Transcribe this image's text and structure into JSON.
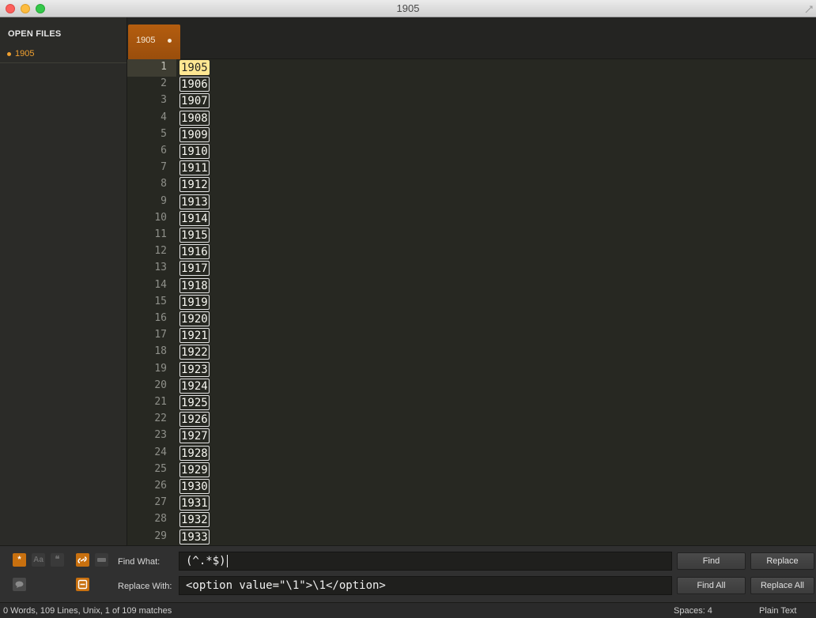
{
  "window": {
    "title": "1905"
  },
  "sidebar": {
    "header": "OPEN FILES",
    "files": [
      {
        "label": "1905",
        "modified": true
      }
    ]
  },
  "tabs": [
    {
      "label": "1905",
      "modified": true,
      "active": true
    }
  ],
  "editor": {
    "current_line": 1,
    "lines": [
      {
        "n": "1",
        "text": "1905"
      },
      {
        "n": "2",
        "text": "1906"
      },
      {
        "n": "3",
        "text": "1907"
      },
      {
        "n": "4",
        "text": "1908"
      },
      {
        "n": "5",
        "text": "1909"
      },
      {
        "n": "6",
        "text": "1910"
      },
      {
        "n": "7",
        "text": "1911"
      },
      {
        "n": "8",
        "text": "1912"
      },
      {
        "n": "9",
        "text": "1913"
      },
      {
        "n": "10",
        "text": "1914"
      },
      {
        "n": "11",
        "text": "1915"
      },
      {
        "n": "12",
        "text": "1916"
      },
      {
        "n": "13",
        "text": "1917"
      },
      {
        "n": "14",
        "text": "1918"
      },
      {
        "n": "15",
        "text": "1919"
      },
      {
        "n": "16",
        "text": "1920"
      },
      {
        "n": "17",
        "text": "1921"
      },
      {
        "n": "18",
        "text": "1922"
      },
      {
        "n": "19",
        "text": "1923"
      },
      {
        "n": "20",
        "text": "1924"
      },
      {
        "n": "21",
        "text": "1925"
      },
      {
        "n": "22",
        "text": "1926"
      },
      {
        "n": "23",
        "text": "1927"
      },
      {
        "n": "24",
        "text": "1928"
      },
      {
        "n": "25",
        "text": "1929"
      },
      {
        "n": "26",
        "text": "1930"
      },
      {
        "n": "27",
        "text": "1931"
      },
      {
        "n": "28",
        "text": "1932"
      },
      {
        "n": "29",
        "text": "1933"
      }
    ]
  },
  "find_panel": {
    "options": {
      "regex": {
        "icon": "asterisk-icon",
        "glyph": "*",
        "on": true
      },
      "case_sensitive": {
        "icon": "case-icon",
        "glyph": "Aa",
        "on": false
      },
      "whole_word": {
        "icon": "quote-icon",
        "glyph": "❝",
        "on": false
      },
      "wrap": {
        "icon": "wrap-icon",
        "on": true
      },
      "in_selection": {
        "icon": "selection-icon",
        "on": false
      },
      "highlight": {
        "icon": "highlight-icon",
        "on": true
      },
      "preserve_case": {
        "icon": "speech-bubble-icon",
        "on": false
      }
    },
    "find_label": "Find What:",
    "find_value": "(^.*$)",
    "replace_label": "Replace With:",
    "replace_value": "<option value=\"\\1\">\\1</option>",
    "buttons": {
      "find": "Find",
      "replace": "Replace",
      "find_all": "Find All",
      "replace_all": "Replace All"
    }
  },
  "status_bar": {
    "info": "0 Words, 109 Lines, Unix, 1 of 109 matches",
    "indent": "Spaces: 4",
    "syntax": "Plain Text"
  },
  "colors": {
    "accent": "#c8700f",
    "editor_bg": "#272822",
    "match_highlight": "#ffe792"
  }
}
